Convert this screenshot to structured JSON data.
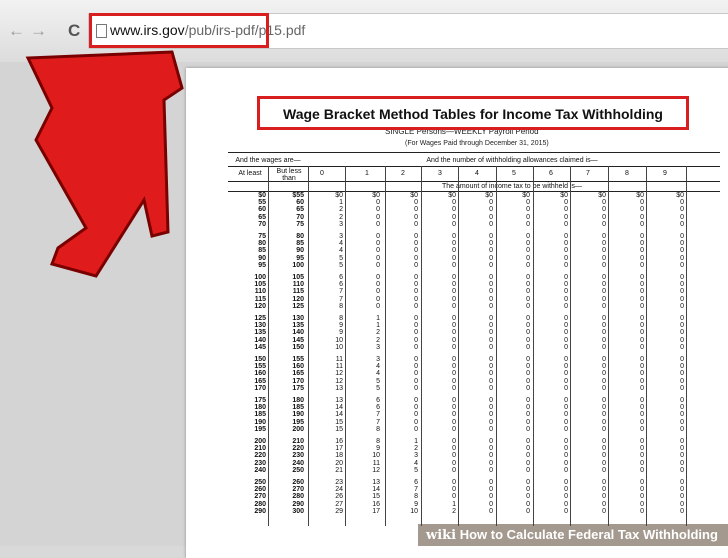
{
  "browser": {
    "nav_back": "←",
    "nav_forward": "→",
    "nav_reload": "C",
    "url_domain": "www.irs.gov",
    "url_path": "/pub/irs-pdf/p15.pdf"
  },
  "doc": {
    "title": "Wage Bracket Method Tables for Income Tax Withholding",
    "subtitle": "SINGLE Persons—WEEKLY Payroll Period",
    "subtitle2": "(For Wages Paid through December 31, 2015)",
    "hdr_wages": "And the wages are—",
    "hdr_allowances": "And the number of withholding allowances claimed is—",
    "hdr_at_least": "At least",
    "hdr_but_less": "But less than",
    "hdr_amount": "The amount of income tax to be withheld is—",
    "columns": [
      "0",
      "1",
      "2",
      "3",
      "4",
      "5",
      "6",
      "7",
      "8",
      "9"
    ],
    "rows": [
      [
        "$0",
        "$55",
        "$0",
        "$0"
      ],
      [
        "55",
        "60",
        "1",
        "0"
      ],
      [
        "60",
        "65",
        "2",
        "0"
      ],
      [
        "65",
        "70",
        "2",
        "0"
      ],
      [
        "70",
        "75",
        "3",
        "0"
      ],
      [
        "75",
        "80",
        "3",
        "0"
      ],
      [
        "80",
        "85",
        "4",
        "0"
      ],
      [
        "85",
        "90",
        "4",
        "0"
      ],
      [
        "90",
        "95",
        "5",
        "0"
      ],
      [
        "95",
        "100",
        "5",
        "0"
      ],
      [
        "100",
        "105",
        "6",
        "0"
      ],
      [
        "105",
        "110",
        "6",
        "0"
      ],
      [
        "110",
        "115",
        "7",
        "0"
      ],
      [
        "115",
        "120",
        "7",
        "0"
      ],
      [
        "120",
        "125",
        "8",
        "0"
      ],
      [
        "125",
        "130",
        "8",
        "1"
      ],
      [
        "130",
        "135",
        "9",
        "1"
      ],
      [
        "135",
        "140",
        "9",
        "2"
      ],
      [
        "140",
        "145",
        "10",
        "2"
      ],
      [
        "145",
        "150",
        "10",
        "3"
      ],
      [
        "150",
        "155",
        "11",
        "3"
      ],
      [
        "155",
        "160",
        "11",
        "4"
      ],
      [
        "160",
        "165",
        "12",
        "4"
      ],
      [
        "165",
        "170",
        "12",
        "5"
      ],
      [
        "170",
        "175",
        "13",
        "5"
      ],
      [
        "175",
        "180",
        "13",
        "6"
      ],
      [
        "180",
        "185",
        "14",
        "6"
      ],
      [
        "185",
        "190",
        "14",
        "7"
      ],
      [
        "190",
        "195",
        "15",
        "7"
      ],
      [
        "195",
        "200",
        "15",
        "8"
      ],
      [
        "200",
        "210",
        "16",
        "8"
      ],
      [
        "210",
        "220",
        "17",
        "9"
      ],
      [
        "220",
        "230",
        "18",
        "10"
      ],
      [
        "230",
        "240",
        "20",
        "11"
      ],
      [
        "240",
        "250",
        "21",
        "12"
      ],
      [
        "250",
        "260",
        "23",
        "13"
      ],
      [
        "260",
        "270",
        "24",
        "14"
      ],
      [
        "270",
        "280",
        "26",
        "15"
      ],
      [
        "280",
        "290",
        "27",
        "16"
      ],
      [
        "290",
        "300",
        "29",
        "17"
      ]
    ],
    "col2": [
      "$0",
      "0",
      "0",
      "0",
      "0",
      "0",
      "0",
      "0",
      "0",
      "0",
      "0",
      "0",
      "0",
      "0",
      "0",
      "0",
      "0",
      "0",
      "0",
      "0",
      "0",
      "0",
      "0",
      "0",
      "0",
      "0",
      "0",
      "0",
      "0",
      "0",
      "1",
      "2",
      "3",
      "4",
      "5",
      "6",
      "7",
      "8",
      "9",
      "10"
    ],
    "col3": [
      "$0",
      "0",
      "0",
      "0",
      "0",
      "0",
      "0",
      "0",
      "0",
      "0",
      "0",
      "0",
      "0",
      "0",
      "0",
      "0",
      "0",
      "0",
      "0",
      "0",
      "0",
      "0",
      "0",
      "0",
      "0",
      "0",
      "0",
      "0",
      "0",
      "0",
      "0",
      "0",
      "0",
      "0",
      "0",
      "0",
      "0",
      "0",
      "1",
      "2"
    ]
  },
  "footer": {
    "wiki": "wiki",
    "caption": "How to Calculate Federal Tax Withholding"
  },
  "colors": {
    "highlight": "#d81e1e",
    "arrow": "#e01b1b"
  }
}
